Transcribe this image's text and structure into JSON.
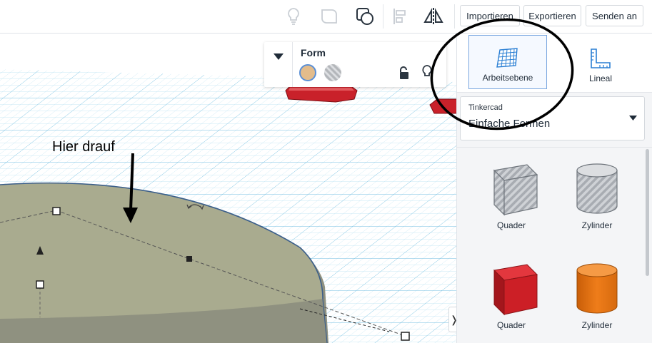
{
  "toolbar": {
    "import_label": "Importieren",
    "export_label": "Exportieren",
    "send_label": "Senden an",
    "icons": [
      "lightbulb-icon",
      "shape-outline-icon",
      "group-shape-icon",
      "align-icon",
      "mirror-icon"
    ]
  },
  "inspector": {
    "title": "Form",
    "colors": {
      "solid": "#e3bc8b",
      "hole": "striped-gray"
    }
  },
  "annotation": {
    "text": "Hier drauf"
  },
  "panel": {
    "workplane_label": "Arbeitsebene",
    "ruler_label": "Lineal",
    "category_group": "Tinkercad",
    "category_value": "Einfache Formen",
    "shapes": [
      {
        "label": "Quader",
        "style": "hole"
      },
      {
        "label": "Zylinder",
        "style": "hole"
      },
      {
        "label": "Quader",
        "style": "red"
      },
      {
        "label": "Zylinder",
        "style": "orange"
      }
    ]
  },
  "colors": {
    "grid": "#8ecbe8",
    "shape_top": "#a9ab8f",
    "shape_side": "#8f9180",
    "accent_red": "#cc1f26",
    "accent_orange": "#ef7d1a"
  }
}
